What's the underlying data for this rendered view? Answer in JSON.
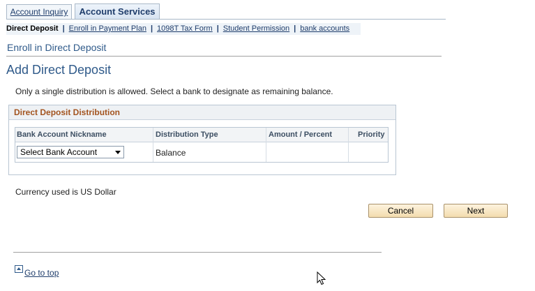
{
  "tabs": [
    {
      "label": "Account Inquiry",
      "active": false
    },
    {
      "label": "Account Services",
      "active": true
    }
  ],
  "subnav": {
    "current": "Direct Deposit",
    "links": [
      "Enroll in Payment Plan",
      "1098T Tax Form",
      "Student Permission",
      "bank accounts"
    ],
    "separator": "|"
  },
  "breadcrumb_title": "Enroll in Direct Deposit",
  "page_title": "Add Direct Deposit",
  "instructions": "Only a single distribution is allowed. Select a bank to designate as remaining balance.",
  "group": {
    "title": "Direct Deposit Distribution",
    "columns": [
      "Bank Account Nickname",
      "Distribution Type",
      "Amount / Percent",
      "Priority"
    ],
    "row": {
      "bank_select_value": "Select Bank Account",
      "distribution_type": "Balance",
      "amount_percent": "",
      "priority": ""
    }
  },
  "currency_text": "Currency used is US Dollar",
  "buttons": {
    "cancel": "Cancel",
    "next": "Next"
  },
  "go_to_top": "Go to top",
  "colors": {
    "accent": "#2f5a8a",
    "group_title": "#a3541f",
    "button_bg": "#f3dcae"
  },
  "icons": [
    "chevron-down-icon",
    "go-to-top-icon",
    "mouse-cursor-icon"
  ]
}
